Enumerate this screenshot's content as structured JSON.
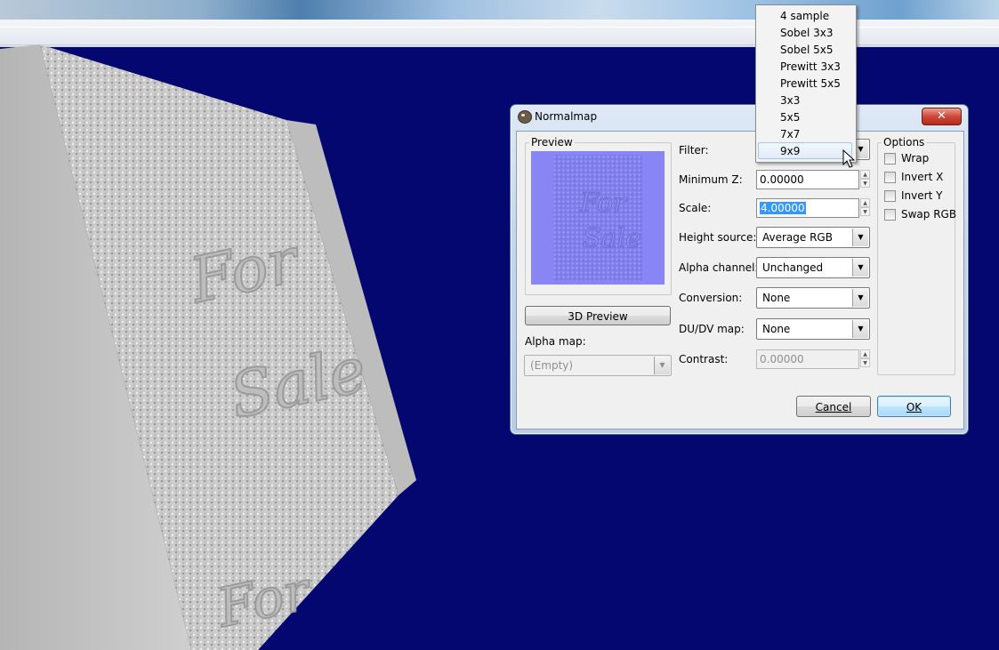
{
  "dialog": {
    "title": "Normalmap",
    "close_glyph": "✕",
    "preview_group_label": "Preview",
    "preview_button_label": "3D Preview",
    "alpha_map": {
      "label": "Alpha map:",
      "value": "(Empty)"
    },
    "fields": {
      "filter": {
        "label": "Filter:"
      },
      "minimum_z": {
        "label": "Minimum Z:",
        "value": "0.00000"
      },
      "scale": {
        "label": "Scale:",
        "value": "4.00000"
      },
      "height_source": {
        "label": "Height source:",
        "value": "Average RGB"
      },
      "alpha_channel": {
        "label": "Alpha channel:",
        "value": "Unchanged"
      },
      "conversion": {
        "label": "Conversion:",
        "value": "None"
      },
      "dudv_map": {
        "label": "DU/DV map:",
        "value": "None"
      },
      "contrast": {
        "label": "Contrast:",
        "value": "0.00000"
      }
    },
    "options": {
      "group_label": "Options",
      "wrap": "Wrap",
      "invert_x": "Invert X",
      "invert_y": "Invert Y",
      "swap_rgb": "Swap RGB"
    },
    "buttons": {
      "cancel": "Cancel",
      "ok": "OK"
    }
  },
  "filter_dropdown": {
    "items": [
      "4 sample",
      "Sobel 3x3",
      "Sobel 5x5",
      "Prewitt 3x3",
      "Prewitt 5x5",
      "3x3",
      "5x5",
      "7x7",
      "9x9"
    ],
    "hovered": "9x9"
  },
  "scene": {
    "embossed_text_line1": "For",
    "embossed_text_line2": "Sale",
    "background_color": "#050770"
  },
  "icons": {
    "app": "gimp-icon",
    "combo_arrow": "▼",
    "spin_up": "▲",
    "spin_down": "▼"
  }
}
